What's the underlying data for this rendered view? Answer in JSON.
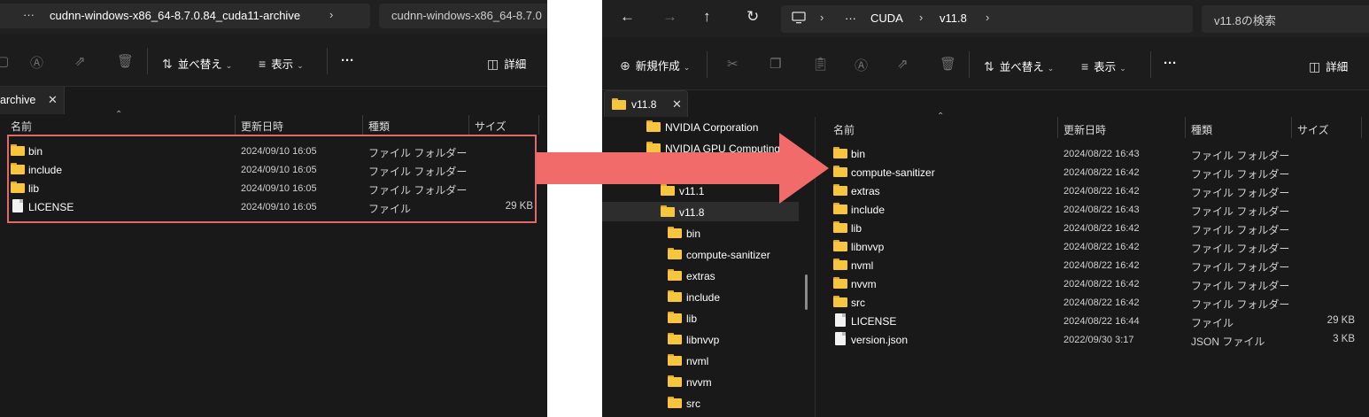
{
  "left_window": {
    "address": {
      "dots": "···",
      "path": "cudnn-windows-x86_64-8.7.0.84_cuda11-archive",
      "chevron": "›",
      "search_text": "cudnn-windows-x86_64-8.7.0"
    },
    "toolbar": {
      "sort_label": "並べ替え",
      "view_label": "表示",
      "more_label": "···",
      "details_label": "詳細"
    },
    "tab": {
      "label": "archive",
      "close": "✕"
    },
    "columns": {
      "name": "名前",
      "date": "更新日時",
      "type": "種類",
      "size": "サイズ"
    },
    "rows": [
      {
        "icon": "folder-icon",
        "name": "bin",
        "date": "2024/09/10 16:05",
        "type": "ファイル フォルダー",
        "size": ""
      },
      {
        "icon": "folder-icon",
        "name": "include",
        "date": "2024/09/10 16:05",
        "type": "ファイル フォルダー",
        "size": ""
      },
      {
        "icon": "folder-icon",
        "name": "lib",
        "date": "2024/09/10 16:05",
        "type": "ファイル フォルダー",
        "size": ""
      },
      {
        "icon": "file-icon",
        "name": "LICENSE",
        "date": "2024/09/10 16:05",
        "type": "ファイル",
        "size": "29 KB"
      }
    ]
  },
  "right_window": {
    "address": {
      "dots": "···",
      "seg1": "CUDA",
      "seg2": "v11.8",
      "search_placeholder": "v11.8の検索"
    },
    "toolbar": {
      "new_label": "新規作成",
      "sort_label": "並べ替え",
      "view_label": "表示",
      "more_label": "···",
      "details_label": "詳細"
    },
    "tab": {
      "label": "v11.8",
      "close": "✕"
    },
    "tree": [
      {
        "name": "NVIDIA Corporation",
        "indent": 1,
        "selected": false
      },
      {
        "name": "NVIDIA GPU Computing T",
        "indent": 1,
        "selected": false
      },
      {
        "name": "v11.1",
        "indent": 2,
        "selected": false
      },
      {
        "name": "v11.8",
        "indent": 2,
        "selected": true
      },
      {
        "name": "bin",
        "indent": 3,
        "selected": false
      },
      {
        "name": "compute-sanitizer",
        "indent": 3,
        "selected": false
      },
      {
        "name": "extras",
        "indent": 3,
        "selected": false
      },
      {
        "name": "include",
        "indent": 3,
        "selected": false
      },
      {
        "name": "lib",
        "indent": 3,
        "selected": false
      },
      {
        "name": "libnvvp",
        "indent": 3,
        "selected": false
      },
      {
        "name": "nvml",
        "indent": 3,
        "selected": false
      },
      {
        "name": "nvvm",
        "indent": 3,
        "selected": false
      },
      {
        "name": "src",
        "indent": 3,
        "selected": false
      }
    ],
    "columns": {
      "name": "名前",
      "date": "更新日時",
      "type": "種類",
      "size": "サイズ"
    },
    "rows": [
      {
        "icon": "folder-icon",
        "name": "bin",
        "date": "2024/08/22 16:43",
        "type": "ファイル フォルダー",
        "size": ""
      },
      {
        "icon": "folder-icon",
        "name": "compute-sanitizer",
        "date": "2024/08/22 16:42",
        "type": "ファイル フォルダー",
        "size": ""
      },
      {
        "icon": "folder-icon",
        "name": "extras",
        "date": "2024/08/22 16:42",
        "type": "ファイル フォルダー",
        "size": ""
      },
      {
        "icon": "folder-icon",
        "name": "include",
        "date": "2024/08/22 16:43",
        "type": "ファイル フォルダー",
        "size": ""
      },
      {
        "icon": "folder-icon",
        "name": "lib",
        "date": "2024/08/22 16:42",
        "type": "ファイル フォルダー",
        "size": ""
      },
      {
        "icon": "folder-icon",
        "name": "libnvvp",
        "date": "2024/08/22 16:42",
        "type": "ファイル フォルダー",
        "size": ""
      },
      {
        "icon": "folder-icon",
        "name": "nvml",
        "date": "2024/08/22 16:42",
        "type": "ファイル フォルダー",
        "size": ""
      },
      {
        "icon": "folder-icon",
        "name": "nvvm",
        "date": "2024/08/22 16:42",
        "type": "ファイル フォルダー",
        "size": ""
      },
      {
        "icon": "folder-icon",
        "name": "src",
        "date": "2024/08/22 16:42",
        "type": "ファイル フォルダー",
        "size": ""
      },
      {
        "icon": "file-icon",
        "name": "LICENSE",
        "date": "2024/08/22 16:44",
        "type": "ファイル",
        "size": "29 KB"
      },
      {
        "icon": "file-icon",
        "name": "version.json",
        "date": "2022/09/30 3:17",
        "type": "JSON ファイル",
        "size": "3 KB"
      }
    ]
  },
  "colors": {
    "window_bg": "#191919",
    "highlight_border": "#e06a6a",
    "arrow_fill": "#f26b6b",
    "folder_yellow": "#f8c53e"
  }
}
